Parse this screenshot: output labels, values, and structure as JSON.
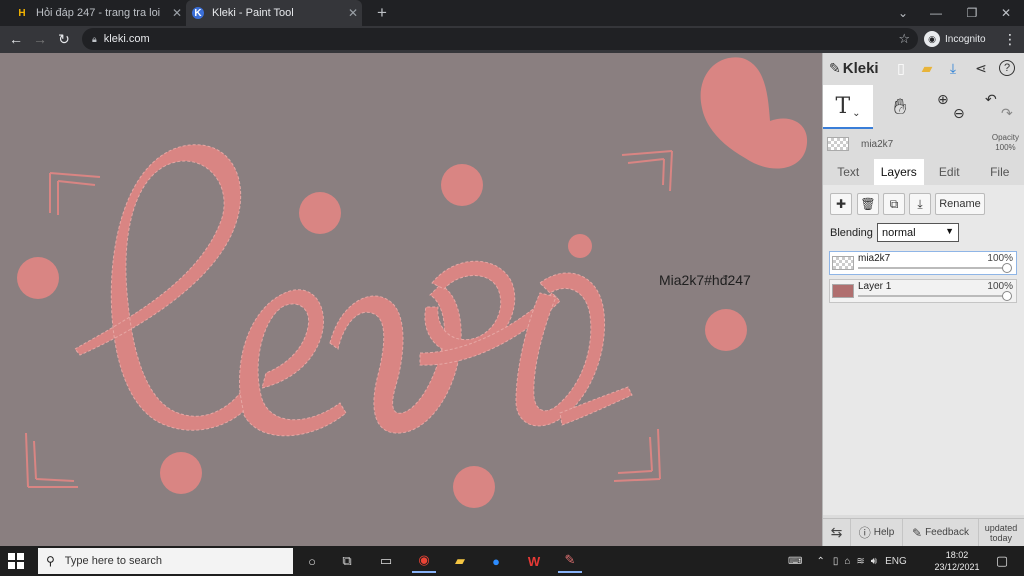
{
  "browser": {
    "tabs": [
      {
        "title": "Hỏi đáp 247 - trang tra loi",
        "favicon": "H",
        "active": false
      },
      {
        "title": "Kleki - Paint Tool",
        "favicon": "K",
        "active": true
      }
    ],
    "new_tab": "+",
    "url": "kleki.com",
    "incognito_label": "Incognito"
  },
  "canvas": {
    "watermark": "Mia2k7#hđ247",
    "background_color": "#8a7f80",
    "paint_color": "#d98583"
  },
  "kleki": {
    "brand": "Kleki",
    "active_tool": "text",
    "preview_layer": {
      "name": "mia2k7",
      "opacity_label": "Opacity",
      "opacity_value": "100%"
    },
    "tabs": [
      "Text",
      "Layers",
      "Edit",
      "File"
    ],
    "active_tab": "Layers",
    "rename_label": "Rename",
    "blending_label": "Blending",
    "blending_value": "normal",
    "layers": [
      {
        "name": "mia2k7",
        "opacity": "100%",
        "selected": true
      },
      {
        "name": "Layer 1",
        "opacity": "100%",
        "selected": false
      }
    ],
    "bottom": {
      "help": "Help",
      "feedback": "Feedback",
      "updated": "updated today"
    }
  },
  "taskbar": {
    "search_placeholder": "Type here to search",
    "language": "ENG",
    "time": "18:02",
    "date": "23/12/2021"
  }
}
